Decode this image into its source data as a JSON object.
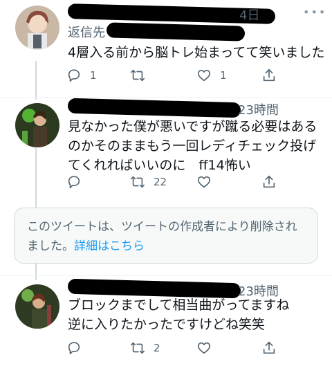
{
  "tweets": [
    {
      "reply_prefix": "返信先",
      "time": "4日",
      "text": "4層入る前から脳トレ始まってて笑いました",
      "replies": "1",
      "retweets": "",
      "likes": "1"
    },
    {
      "time": "23時間",
      "text": "見なかった僕が悪いですが蹴る必要はあるのかそのままもう一回レディチェック投げてくれればいいのに　ff14怖い",
      "replies": "",
      "retweets": "22",
      "likes": ""
    },
    {
      "time": "23時間",
      "text": "ブロックまでして相当曲がってますね\n逆に入りたかったですけどね笑笑",
      "replies": "",
      "retweets": "2",
      "likes": ""
    }
  ],
  "deleted_notice": {
    "text": "このツイートは、ツイートの作成者により削除されました。",
    "link": "詳細はこちら"
  },
  "icons": [
    "reply-icon",
    "retweet-icon",
    "like-icon",
    "share-icon",
    "more-icon"
  ],
  "colors": {
    "muted": "#536471",
    "link": "#1d9bf0",
    "border": "#cfd9de",
    "text": "#0f1419"
  }
}
